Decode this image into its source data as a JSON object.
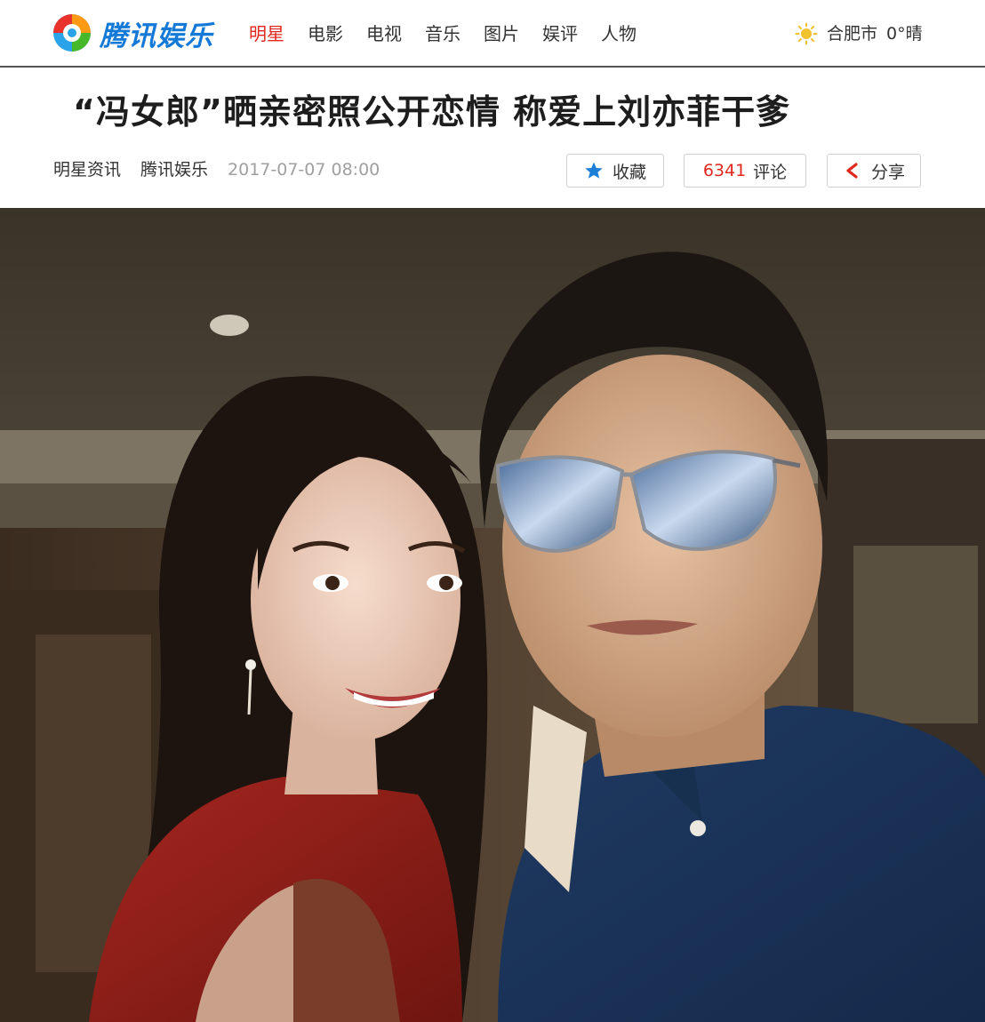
{
  "header": {
    "logo_text": "腾讯娱乐",
    "nav": [
      {
        "label": "明星",
        "active": true
      },
      {
        "label": "电影",
        "active": false
      },
      {
        "label": "电视",
        "active": false
      },
      {
        "label": "音乐",
        "active": false
      },
      {
        "label": "图片",
        "active": false
      },
      {
        "label": "娱评",
        "active": false
      },
      {
        "label": "人物",
        "active": false
      }
    ],
    "weather": {
      "icon": "sun-icon",
      "city": "合肥市",
      "temp": "0°晴"
    }
  },
  "article": {
    "title": "“冯女郎”晒亲密照公开恋情 称爱上刘亦菲干爹",
    "category": "明星资讯",
    "source": "腾讯娱乐",
    "date": "2017-07-07 08:00",
    "actions": {
      "favorite": {
        "icon": "star-icon",
        "label": "收藏"
      },
      "comments": {
        "count": "6341",
        "label": "评论"
      },
      "share": {
        "icon": "share-icon",
        "label": "分享"
      }
    }
  },
  "colors": {
    "accent_red": "#e1281e",
    "brand_blue": "#1479d7",
    "star_blue": "#1e7fd8"
  }
}
